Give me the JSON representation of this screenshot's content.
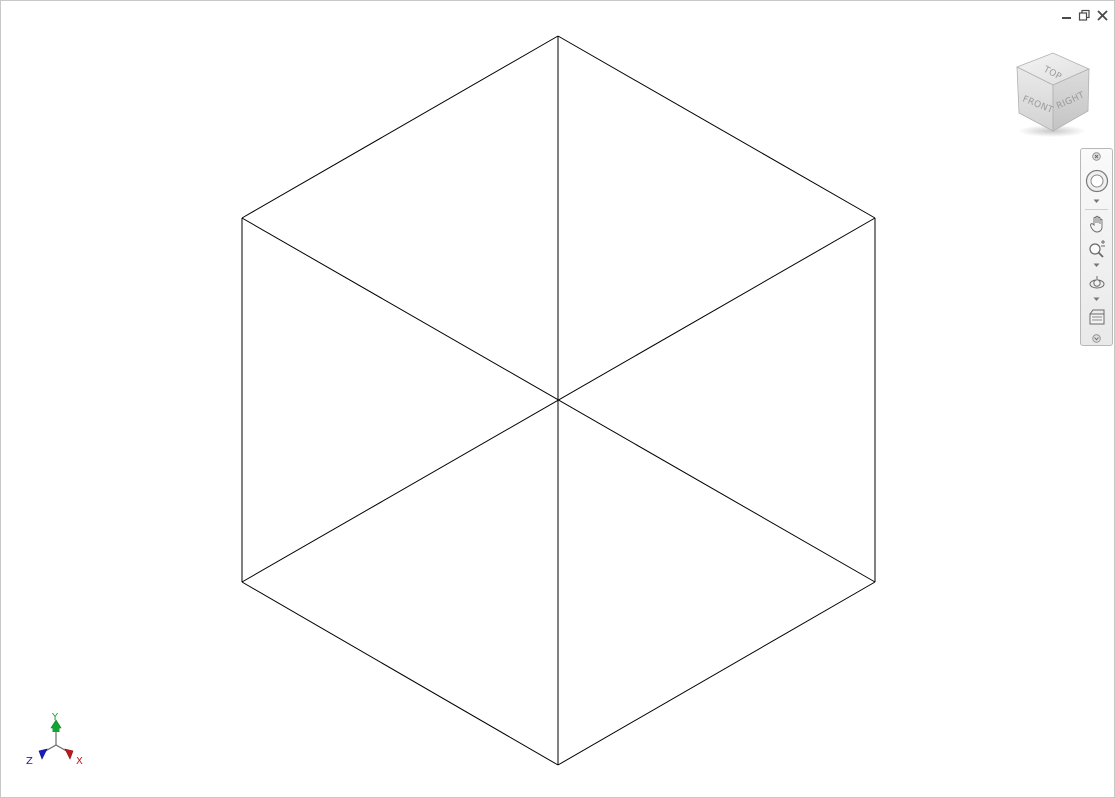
{
  "window_controls": {
    "minimize": "minimize",
    "restore": "restore",
    "close": "close"
  },
  "viewcube": {
    "faces": {
      "top": "TOP",
      "front": "FRONT",
      "right": "RIGHT"
    }
  },
  "navbar": {
    "tools": [
      "close-icon",
      "steering-wheel-icon",
      "pan-hand-icon",
      "zoom-icon",
      "orbit-icon",
      "showmotion-icon",
      "customize-icon"
    ]
  },
  "ucs": {
    "x_label": "X",
    "y_label": "Y",
    "z_label": "Z",
    "colors": {
      "x": "#c0191c",
      "y": "#12a532",
      "z": "#1b1bbf"
    }
  },
  "model": {
    "description_color": "#000000"
  }
}
